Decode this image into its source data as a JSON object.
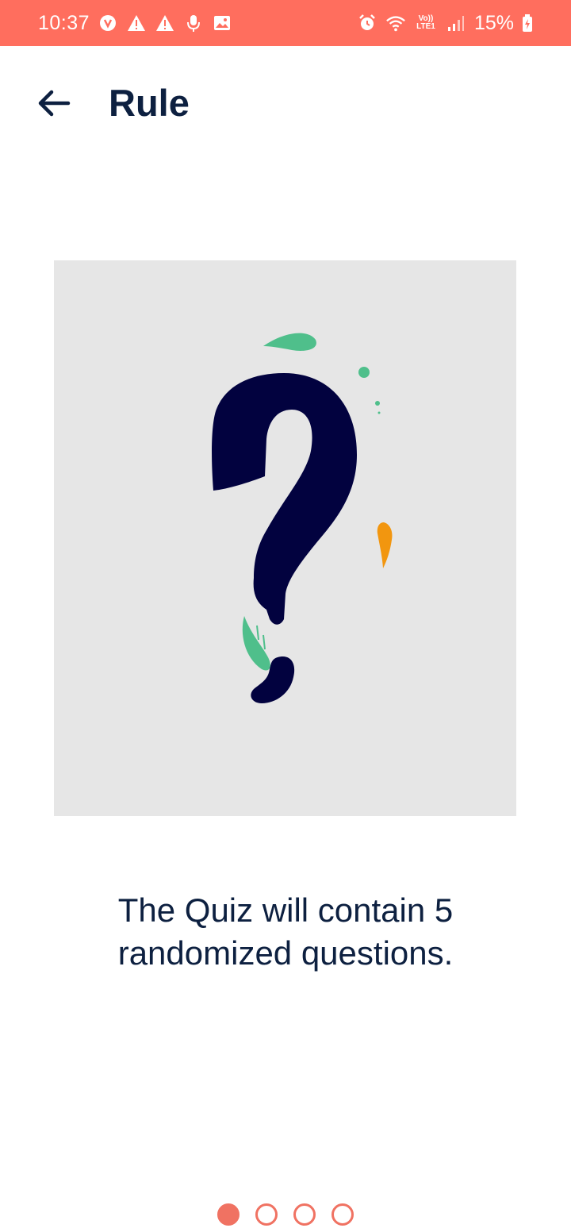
{
  "status_bar": {
    "time": "10:37",
    "battery": "15%",
    "network_label_top": "Vo))",
    "network_label_bottom": "LTE1",
    "left_icons": [
      "vpn-icon",
      "warning-icon",
      "warning-icon",
      "microphone-icon",
      "image-icon"
    ],
    "right_icons": [
      "alarm-icon",
      "wifi-icon",
      "signal-icon",
      "battery-charging-icon"
    ]
  },
  "header": {
    "title": "Rule",
    "back_icon": "arrow-left-icon"
  },
  "illustration": {
    "icon": "question-mark-illustration",
    "background": "#e6e6e6",
    "primary_color": "#02023f",
    "accent_green": "#4fbf8b",
    "accent_orange": "#f2960f"
  },
  "rule": {
    "text": "The Quiz will contain 5 randomized questions."
  },
  "pager": {
    "count": 4,
    "active_index": 0,
    "color": "#f07262"
  },
  "colors": {
    "status_bar": "#ff6e5e",
    "text": "#0d2040"
  }
}
